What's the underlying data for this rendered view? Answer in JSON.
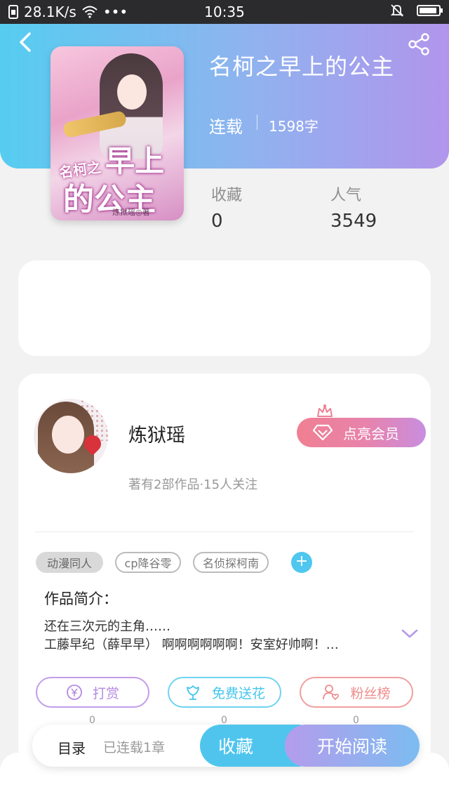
{
  "status_bar": {
    "speed": "28.1K/s",
    "dots": "•••",
    "time": "10:35"
  },
  "book": {
    "title": "名柯之早上的公主",
    "status": "连载",
    "words": "1598字",
    "cover_text": {
      "line1": "名柯之",
      "line2": "早上",
      "line3": "的公主",
      "author": "炼狱瑶◎著"
    }
  },
  "stats": [
    {
      "label": "收藏",
      "value": "0"
    },
    {
      "label": "人气",
      "value": "3549"
    }
  ],
  "author": {
    "name": "炼狱瑶",
    "meta": "著有2部作品·15人关注",
    "vip_label": "点亮会员"
  },
  "tags": [
    "动漫同人",
    "cp降谷零",
    "名侦探柯南"
  ],
  "tag_add": "+",
  "intro": {
    "title": "作品简介：",
    "text": "还在三次元的主角……\n工藤早纪（薛早早） 啊啊啊啊啊啊！安室好帅啊！…"
  },
  "actions": [
    {
      "label": "打赏",
      "count": "0",
      "color": "#b58ae0"
    },
    {
      "label": "免费送花",
      "count": "0",
      "color": "#45c6ec"
    },
    {
      "label": "粉丝榜",
      "count": "0",
      "color": "#ef8b8b"
    }
  ],
  "bottom_bar": {
    "toc": "目录",
    "toc_meta": "已连载1章",
    "favorite": "收藏",
    "read": "开始阅读"
  },
  "colors": {
    "header_start": "#56cdf0",
    "header_end": "#b195ec",
    "accent_blue": "#4fc5ee"
  }
}
